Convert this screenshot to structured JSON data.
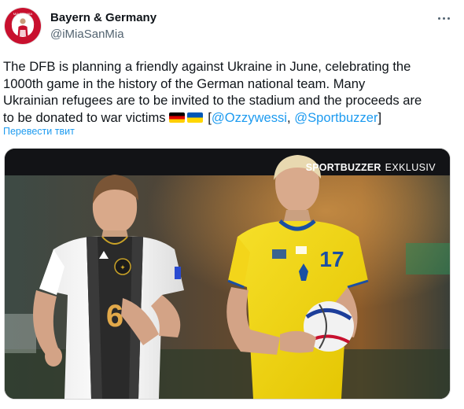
{
  "tweet": {
    "author_name": "Bayern & Germany",
    "author_handle": "@iMiaSanMia",
    "text_lines": [
      "The DFB is planning a friendly against Ukraine in June, celebrating the",
      "1000th game in the history of the German national team. Many",
      "Ukrainian refugees are to be invited to the stadium and the proceeds are"
    ],
    "text_last_prefix": "to be donated to war victims ",
    "text_bracket_open": "[",
    "mention_1": "@Ozzywessi",
    "mention_sep": ", ",
    "mention_2": "@Sportbuzzer",
    "text_bracket_close": "]",
    "translate_label": "Перевести твит",
    "more_icon": "more-horizontal-icon"
  },
  "media": {
    "tag_bold": "SPORTBUZZER",
    "tag_light": "EXKLUSIV",
    "left_player": {
      "kit": "Germany",
      "number": "6"
    },
    "right_player": {
      "kit": "Ukraine",
      "number": "17"
    }
  },
  "colors": {
    "accent_link": "#1d9bf0",
    "secondary_text": "#536471",
    "germany_shirt": "#f4f4f4",
    "ukraine_shirt": "#f5d90a",
    "ukraine_trim": "#1a4fa3"
  }
}
